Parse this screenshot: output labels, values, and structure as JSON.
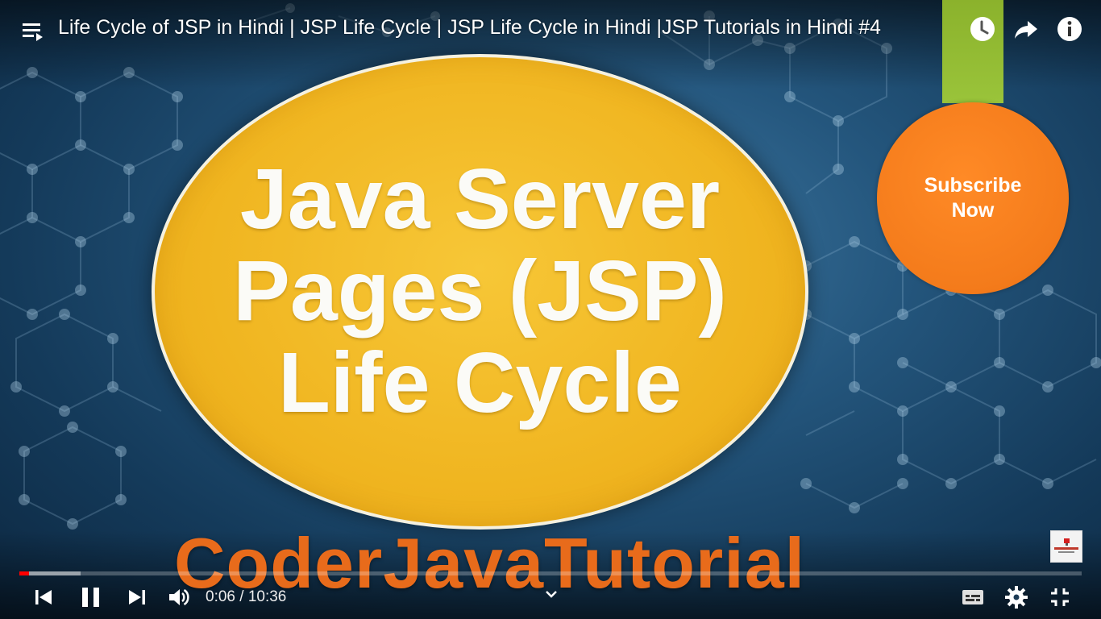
{
  "header": {
    "title": "Life Cycle of JSP in Hindi | JSP Life Cycle | JSP Life Cycle in Hindi |JSP Tutorials in Hindi #4"
  },
  "top_actions": [
    "playlist-icon",
    "clock-icon",
    "share-icon",
    "info-icon"
  ],
  "video_frame": {
    "headline_lines": [
      "Java Server",
      "Pages (JSP)",
      "Life Cycle"
    ],
    "brand_watermark": "CoderJavaTutorial",
    "subscribe_label": "Subscribe Now",
    "colors": {
      "ellipse": "#f0b520",
      "subscribe": "#f47b1b",
      "ribbon": "#9ac43a",
      "watermark": "#e86b1b",
      "background": "#24567d"
    }
  },
  "player": {
    "current_time": "0:06",
    "duration": "10:36",
    "time_display": "0:06 / 10:36",
    "played_fraction": 0.0094,
    "buffered_fraction": 0.058,
    "progress_color": "#ff0000",
    "state": "playing",
    "controls": [
      "previous-icon",
      "pause-icon",
      "next-icon",
      "volume-icon",
      "chevron-down-icon",
      "subtitles-icon",
      "gear-icon",
      "exit-fullscreen-icon"
    ]
  }
}
